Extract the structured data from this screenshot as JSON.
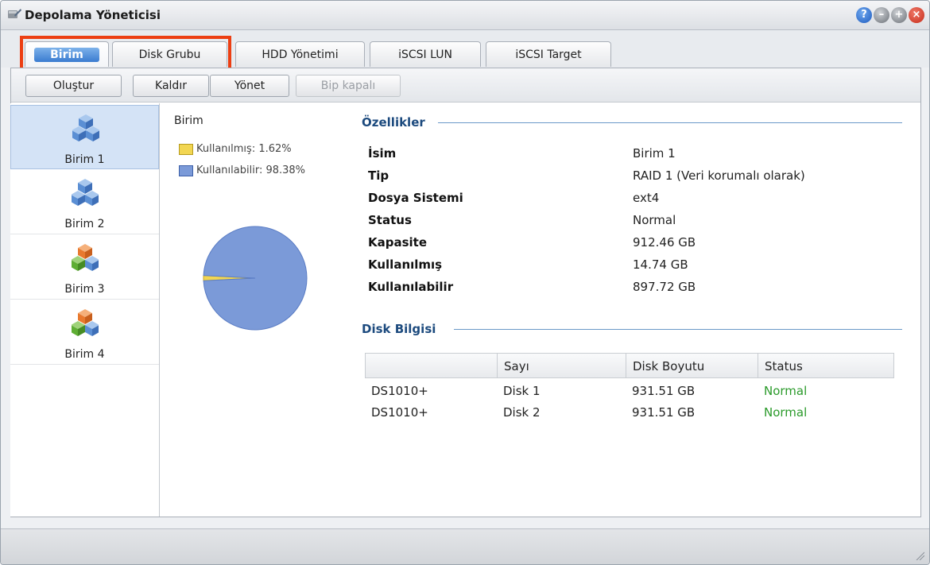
{
  "window": {
    "title": "Depolama Yöneticisi",
    "title_icon": "storage-manager-icon"
  },
  "title_buttons": [
    "help-icon",
    "minimize-icon",
    "maximize-icon",
    "close-icon"
  ],
  "tabs": [
    {
      "label": "Birim",
      "active": true
    },
    {
      "label": "Disk Grubu"
    },
    {
      "label": "HDD Yönetimi"
    },
    {
      "label": "iSCSI LUN"
    },
    {
      "label": "iSCSI Target"
    }
  ],
  "toolbar": {
    "create": "Oluştur",
    "remove": "Kaldır",
    "manage": "Yönet",
    "beep_off": "Bip kapalı"
  },
  "volumes": [
    {
      "label": "Birim 1",
      "selected": true,
      "icon": "volume-blue-icon"
    },
    {
      "label": "Birim 2",
      "icon": "volume-blue-icon"
    },
    {
      "label": "Birim 3",
      "icon": "volume-multicolor-icon"
    },
    {
      "label": "Birim 4",
      "icon": "volume-multicolor-icon"
    }
  ],
  "chart_data": {
    "type": "pie",
    "title": "Birim",
    "categories": [
      "Kullanılmış",
      "Kullanılabilir"
    ],
    "values": [
      1.62,
      98.38
    ],
    "legend": [
      "Kullanılmış: 1.62%",
      "Kullanılabilir: 98.38%"
    ],
    "colors": [
      "#f2d652",
      "#7b9ad8"
    ]
  },
  "properties": {
    "title": "Özellikler",
    "rows": [
      {
        "key": "İsim",
        "value": "Birim 1"
      },
      {
        "key": "Tip",
        "value": "RAID 1 (Veri korumalı olarak)"
      },
      {
        "key": "Dosya Sistemi",
        "value": "ext4"
      },
      {
        "key": "Status",
        "value": "Normal"
      },
      {
        "key": "Kapasite",
        "value": "912.46 GB"
      },
      {
        "key": "Kullanılmış",
        "value": "14.74 GB"
      },
      {
        "key": "Kullanılabilir",
        "value": "897.72 GB"
      }
    ]
  },
  "disk_info": {
    "title": "Disk Bilgisi",
    "headers": [
      "",
      "Sayı",
      "Disk Boyutu",
      "Status"
    ],
    "rows": [
      [
        "DS1010+",
        "Disk 1",
        "931.51 GB",
        "Normal"
      ],
      [
        "DS1010+",
        "Disk 2",
        "931.51 GB",
        "Normal"
      ]
    ],
    "status_color": "#2a9a2a"
  }
}
